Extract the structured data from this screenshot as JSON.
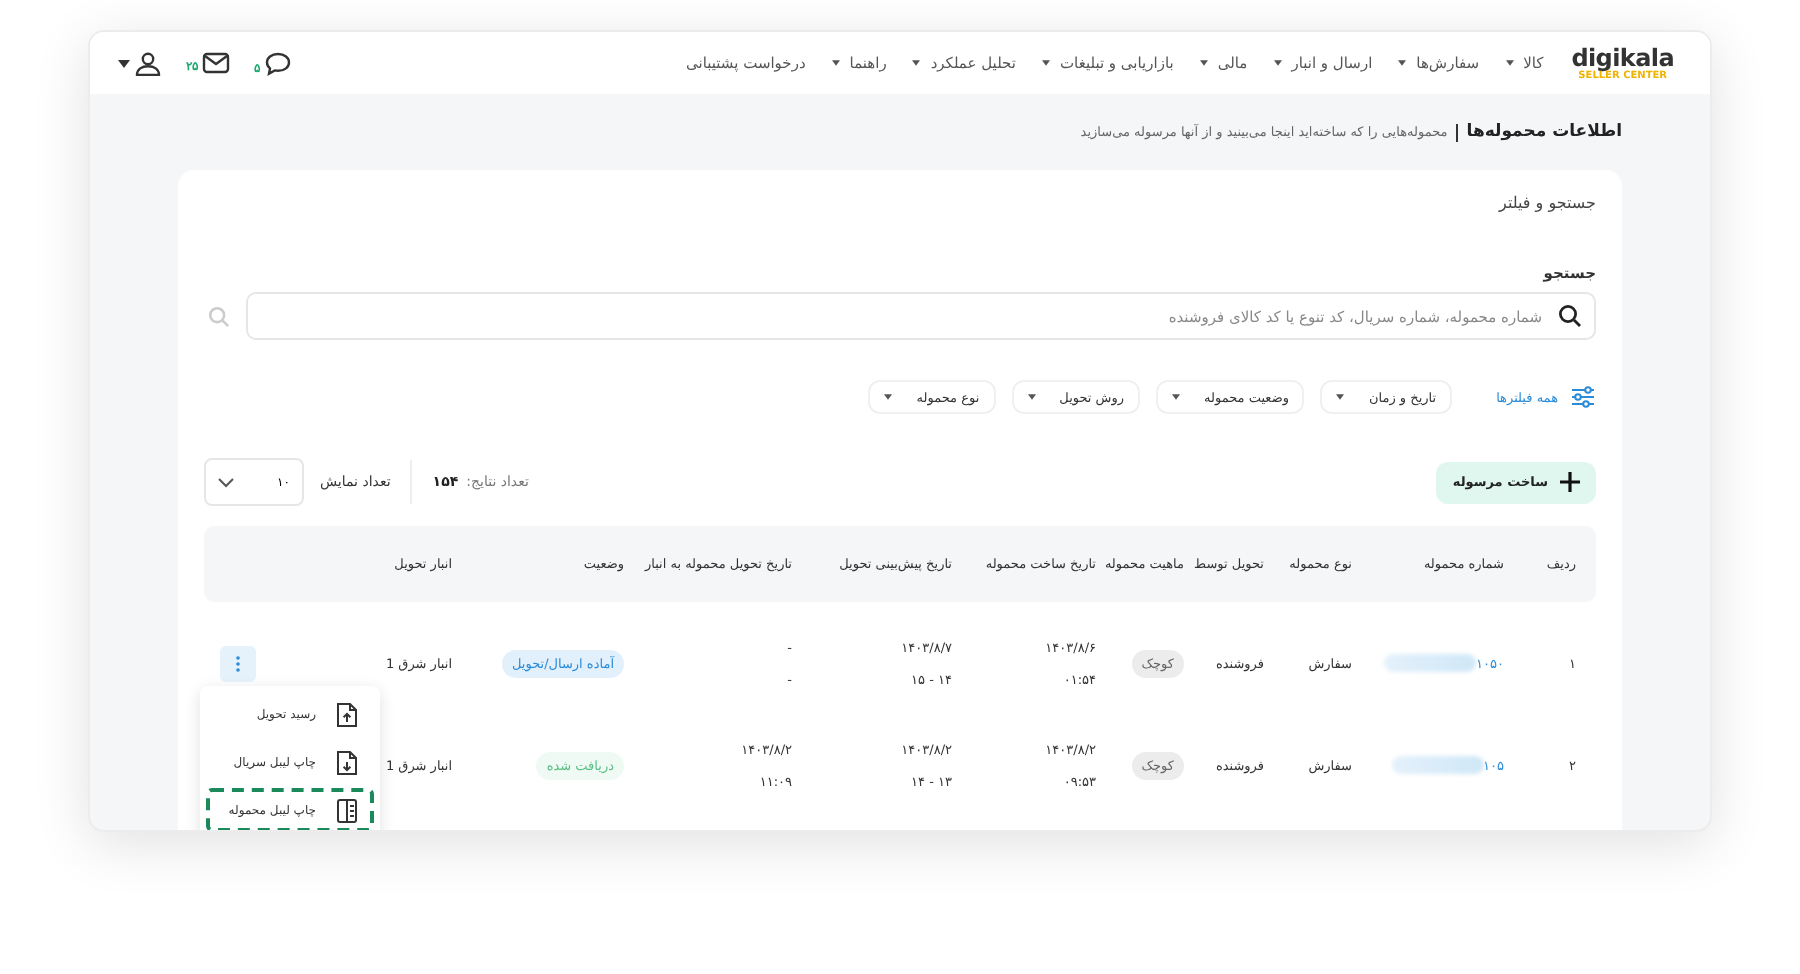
{
  "logo": {
    "name": "digikala",
    "tagline": "SELLER CENTER"
  },
  "nav": [
    {
      "label": "کالا",
      "dropdown": true
    },
    {
      "label": "سفارش‌ها",
      "dropdown": true
    },
    {
      "label": "ارسال و انبار",
      "dropdown": true
    },
    {
      "label": "مالی",
      "dropdown": true
    },
    {
      "label": "بازاریابی و تبلیغات",
      "dropdown": true
    },
    {
      "label": "تحلیل عملکرد",
      "dropdown": true
    },
    {
      "label": "راهنما",
      "dropdown": true
    },
    {
      "label": "درخواست پشتیبانی",
      "dropdown": false
    }
  ],
  "header_actions": {
    "chat_badge": "۵",
    "mail_badge": "۲۵"
  },
  "page": {
    "title": "اطلاعات محموله‌ها",
    "subtitle": "محموله‌هایی را که ساخته‌اید اینجا می‌بینید و از آنها مرسوله می‌سازید"
  },
  "filters": {
    "title": "جستجو و فیلتر",
    "search_label": "جستجو",
    "search_placeholder": "شماره محموله، شماره سریال، کد تنوع یا کد کالای فروشنده",
    "all_filters": "همه فیلترها",
    "dropdowns": [
      "تاریخ و زمان",
      "وضعیت محموله",
      "روش تحویل",
      "نوع محموله"
    ]
  },
  "toolbar": {
    "create_button": "ساخت مرسوله",
    "results_label": "تعداد نتایج:",
    "results_count": "۱۵۴",
    "page_size_label": "تعداد نمایش",
    "page_size": "۱۰"
  },
  "table": {
    "columns": [
      "ردیف",
      "شماره محموله",
      "نوع محموله",
      "تحویل توسط",
      "ماهیت محموله",
      "تاریخ ساخت محموله",
      "تاریخ پیش‌بینی تحویل",
      "تاریخ تحویل محموله به انبار",
      "وضعیت",
      "انبار تحویل"
    ],
    "rows": [
      {
        "index": "۱",
        "shipment_number": "۱۰۵۰",
        "type": "سفارش",
        "delivered_by": "فروشنده",
        "nature": "کوچک",
        "created": [
          "۱۴۰۳/۸/۶",
          "۰۱:۵۴"
        ],
        "expected": [
          "۱۴۰۳/۸/۷",
          "۱۴ - ۱۵"
        ],
        "warehouse_delivery": [
          "-",
          "-"
        ],
        "status": {
          "label": "آماده ارسال/تحویل",
          "kind": "ready"
        },
        "warehouse": "انبار شرق 1",
        "menu": {
          "items": [
            {
              "label": "رسید تحویل",
              "kind": "receipt",
              "selected": false
            },
            {
              "label": "چاپ لیبل سریال",
              "kind": "serial",
              "selected": false
            },
            {
              "label": "چاپ لیبل محموله",
              "kind": "shipment",
              "selected": true
            }
          ]
        }
      },
      {
        "index": "۲",
        "shipment_number": "۱۰۵",
        "type": "سفارش",
        "delivered_by": "فروشنده",
        "nature": "کوچک",
        "created": [
          "۱۴۰۳/۸/۲",
          "۰۹:۵۳"
        ],
        "expected": [
          "۱۴۰۳/۸/۲",
          "۱۳ - ۱۴"
        ],
        "warehouse_delivery": [
          "۱۴۰۳/۸/۲",
          "۱۱:۰۹"
        ],
        "status": {
          "label": "دریافت شده",
          "kind": "received"
        },
        "warehouse": "انبار شرق 1"
      }
    ]
  }
}
